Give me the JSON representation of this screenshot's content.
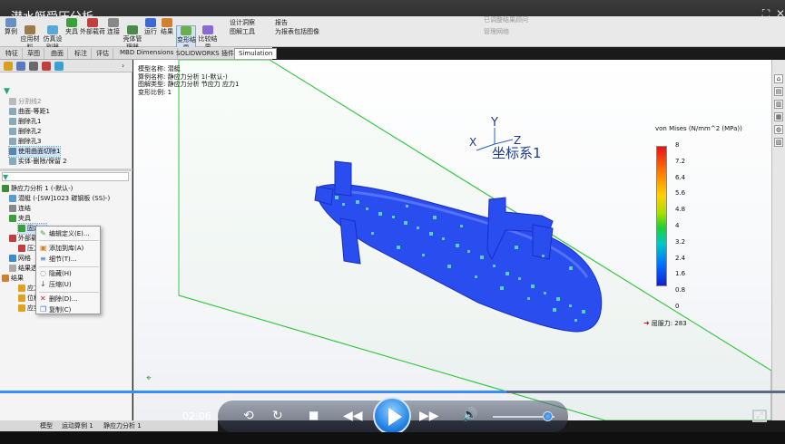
{
  "video": {
    "title": "潜水艇受压分析",
    "time": "02:06",
    "progress_fraction": 0.645
  },
  "ribbon": {
    "buttons": [
      {
        "label": "算例"
      },
      {
        "label": "应用材\n料"
      },
      {
        "label": "仿真设\n别器"
      },
      {
        "label": "夹具"
      },
      {
        "label": "外部载荷"
      },
      {
        "label": "连接"
      },
      {
        "label": "壳体管\n理器"
      },
      {
        "label": "运行"
      },
      {
        "label": "结果"
      },
      {
        "label": "变形结\n果"
      },
      {
        "label": "比较结\n果"
      }
    ],
    "right_labels": {
      "design_insight": "设计洞察",
      "plot_tools": "图解工具",
      "report": "报告",
      "report_image": "为报表包括图像",
      "results_advisor": "已调整结果顾问",
      "manage_network": "管理网络"
    }
  },
  "tabs": [
    "特征",
    "草图",
    "曲面",
    "标注",
    "评估",
    "MBD Dimensions",
    "SOLIDWORKS 插件",
    "Simulation"
  ],
  "active_tab": "Simulation",
  "feature_tree": [
    {
      "label": "分割线2",
      "grey": true
    },
    {
      "label": "曲面-等距1"
    },
    {
      "label": "删除孔1"
    },
    {
      "label": "删除孔2"
    },
    {
      "label": "删除孔3"
    },
    {
      "label": "使用曲面切除1",
      "selected": true
    },
    {
      "label": "实体-删除/保留 2"
    }
  ],
  "study_tree": [
    {
      "label": "静应力分析 1 (-默认-)"
    },
    {
      "label": "潜艇 (-[SW]1023 碳钢板 (SS)-)"
    },
    {
      "label": "连结"
    },
    {
      "label": "夹具"
    },
    {
      "label": "固定-1",
      "selected": true
    },
    {
      "label": "外部载荷"
    },
    {
      "label": "压力"
    },
    {
      "label": "网格"
    },
    {
      "label": "结果选项"
    },
    {
      "label": "结果"
    },
    {
      "label": "应力1"
    },
    {
      "label": "位移1"
    },
    {
      "label": "应变1"
    }
  ],
  "context_menu": [
    {
      "label": "编辑定义(E)...",
      "icon": "edit-icon"
    },
    {
      "label": "添加到库(A)",
      "icon": "library-icon"
    },
    {
      "label": "细节(T)...",
      "icon": "details-icon"
    },
    {
      "label": "隐藏(H)",
      "icon": "hide-icon"
    },
    {
      "label": "压缩(U)",
      "icon": "suppress-icon"
    },
    {
      "label": "删除(D)...",
      "icon": "delete-icon"
    },
    {
      "label": "复制(C)",
      "icon": "copy-icon"
    }
  ],
  "model_info": {
    "model": "模型名称: 潜艇",
    "study": "算例名称: 静应力分析 1(-默认-)",
    "plot_type": "图解类型: 静应力分析 节应力 应力1",
    "deform": "变形比例: 1"
  },
  "coordinate_system": {
    "label": "坐标系1",
    "x_axis": "X",
    "y_axis": "Y",
    "z_axis": "Z"
  },
  "legend": {
    "title": "von Mises (N/mm^2 (MPa))",
    "ticks": [
      "8",
      "7.2",
      "6.4",
      "5.6",
      "4.8",
      "4",
      "3.2",
      "2.4",
      "1.6",
      "0.8",
      "0"
    ],
    "yield_label": "屈服力: 283"
  },
  "status_tabs": [
    "模型",
    "运动算例 1",
    "静应力分析 1"
  ],
  "colors": {
    "accent": "#1a7ae0",
    "submarine": "#2a4df0",
    "plane_edge": "#36c840"
  }
}
